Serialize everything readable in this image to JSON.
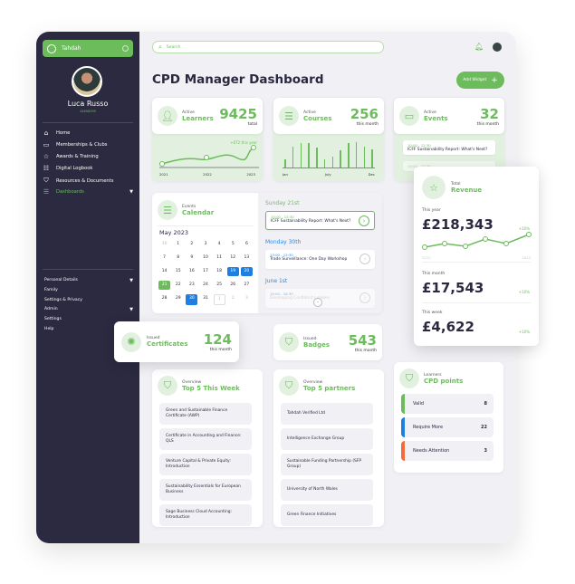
{
  "sidebar": {
    "brand": "Tahdah",
    "user_name": "Luca Russo",
    "user_id": "44658399",
    "nav": [
      {
        "label": "Home",
        "icon": "home-icon"
      },
      {
        "label": "Memberships & Clubs",
        "icon": "id-card-icon"
      },
      {
        "label": "Awards & Training",
        "icon": "star-icon"
      },
      {
        "label": "Digital Logbook",
        "icon": "list-icon"
      },
      {
        "label": "Resources & Documents",
        "icon": "bookmark-icon"
      },
      {
        "label": "Dashboards",
        "icon": "menu-icon",
        "active": true
      }
    ],
    "bottom": [
      {
        "label": "Personal Details",
        "caret": true
      },
      {
        "label": "Family"
      },
      {
        "label": "Settings & Privacy"
      },
      {
        "label": "Admin",
        "caret": true
      },
      {
        "label": "Settings"
      },
      {
        "label": "Help"
      }
    ]
  },
  "header": {
    "search_placeholder": "Search",
    "title": "CPD Manager Dashboard",
    "add_widget": "Add Widget"
  },
  "learners": {
    "label": "Active",
    "title": "Learners",
    "value": "9425",
    "unit": "total",
    "delta": "+672 this year",
    "years": [
      "2021",
      "2022",
      "2023"
    ]
  },
  "courses": {
    "label": "Active",
    "title": "Courses",
    "value": "256",
    "unit": "this month",
    "months": [
      "Jan",
      "July",
      "Dec"
    ],
    "bars": [
      0.35,
      0.85,
      1,
      1,
      0.82,
      0.35,
      0.45,
      0.72,
      1,
      1.05,
      0.85,
      0.75
    ]
  },
  "events": {
    "label": "Active",
    "title": "Events",
    "value": "32",
    "unit": "this month",
    "items": [
      {
        "time": "10:00 - 12:30",
        "title": "ICFF Sustainability Report: What's Next?"
      },
      {
        "time": "10:00 - 12:30",
        "title": ""
      }
    ]
  },
  "calendar": {
    "label": "Events",
    "title": "Calendar",
    "month": "May 2023",
    "days": [
      "30",
      "1",
      "2",
      "3",
      "4",
      "5",
      "6",
      "7",
      "8",
      "9",
      "10",
      "11",
      "12",
      "13",
      "14",
      "15",
      "16",
      "17",
      "18",
      "19",
      "20",
      "21",
      "22",
      "23",
      "24",
      "25",
      "26",
      "27",
      "28",
      "29",
      "30",
      "31",
      "1",
      "2",
      "3"
    ],
    "agenda": [
      {
        "day": "Sunday 21st",
        "time": "10:00 - 12:30",
        "title": "ICFF Sustainability Report: What's Next?"
      },
      {
        "day": "Monday 30th",
        "time": "13:00 - 13:30",
        "title": "Trade Surveillance: One Day Workshop"
      },
      {
        "day": "June 1st",
        "time": "15:00 - 16:30",
        "title": "Developing Confident Leaders"
      }
    ]
  },
  "revenue": {
    "label": "Total",
    "title": "Revenue",
    "year_label": "This year",
    "year_value": "£218,343",
    "year_delta": "+10%",
    "from": "2022",
    "to": "2023",
    "month_label": "This month",
    "month_value": "£17,543",
    "month_delta": "+10%",
    "week_label": "This week",
    "week_value": "£4,622",
    "week_delta": "+10%"
  },
  "certificates": {
    "label": "Issued",
    "title": "Certificates",
    "value": "124",
    "unit": "this month"
  },
  "badges": {
    "label": "Issued",
    "title": "Badges",
    "value": "543",
    "unit": "this month"
  },
  "top5week": {
    "label": "Overview",
    "title": "Top 5 This Week",
    "items": [
      "Green and Sustainable Finance Certificate (AWP)",
      "Certificate in Accounting and Finance: QLS",
      "Venture Capital & Private Equity: Introduction",
      "Sustainability Essentials for European Business",
      "Sage Business Cloud Accounting: Introduction"
    ]
  },
  "top5partners": {
    "label": "Overview",
    "title": "Top 5 partners",
    "items": [
      "Tahdah Verified Ltd",
      "Intelligence Exchange Group",
      "Sustainable Funding Partnership (SFP Group)",
      "University of North Wales",
      "Green Finance Initiatives"
    ]
  },
  "cpd": {
    "label": "Learners",
    "title": "CPD points",
    "items": [
      {
        "label": "Valid",
        "value": "8",
        "color": "#6cbc5c"
      },
      {
        "label": "Require More",
        "value": "22",
        "color": "#1e7fe0"
      },
      {
        "label": "Needs Attention",
        "value": "3",
        "color": "#f46b3b"
      }
    ]
  }
}
